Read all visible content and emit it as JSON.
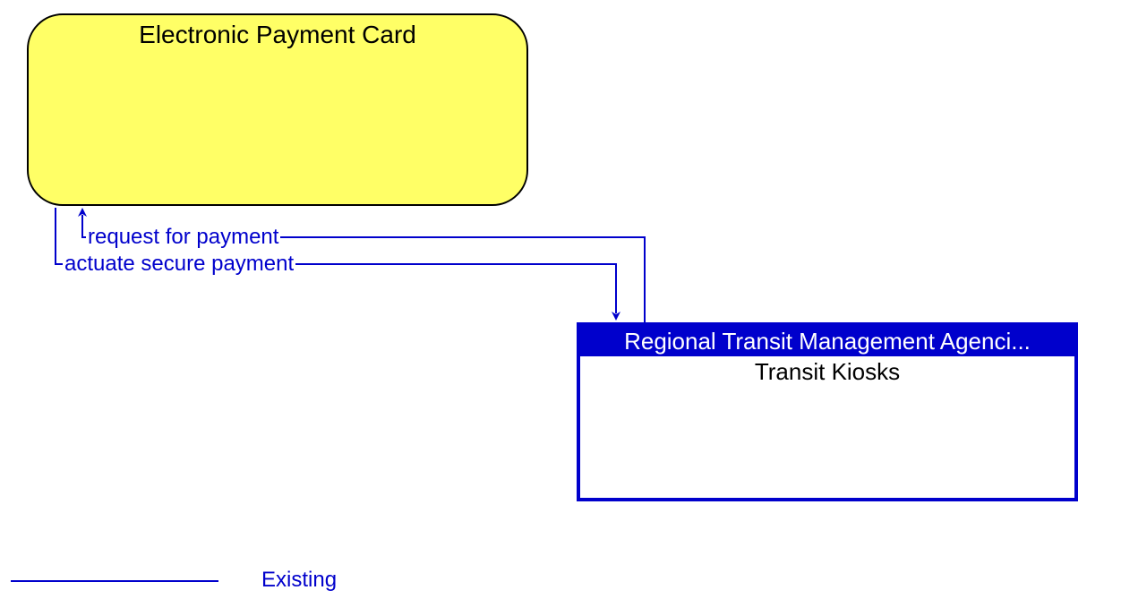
{
  "nodes": {
    "payment_card": {
      "title": "Electronic Payment Card"
    },
    "transit_kiosks": {
      "header": "Regional Transit Management Agenci...",
      "sub": "Transit Kiosks"
    }
  },
  "edges": {
    "request_for_payment": "request for payment",
    "actuate_secure_payment": "actuate secure payment"
  },
  "legend": {
    "existing": "Existing"
  },
  "colors": {
    "accent_blue": "#0000cc",
    "node_yellow": "#ffff66"
  }
}
